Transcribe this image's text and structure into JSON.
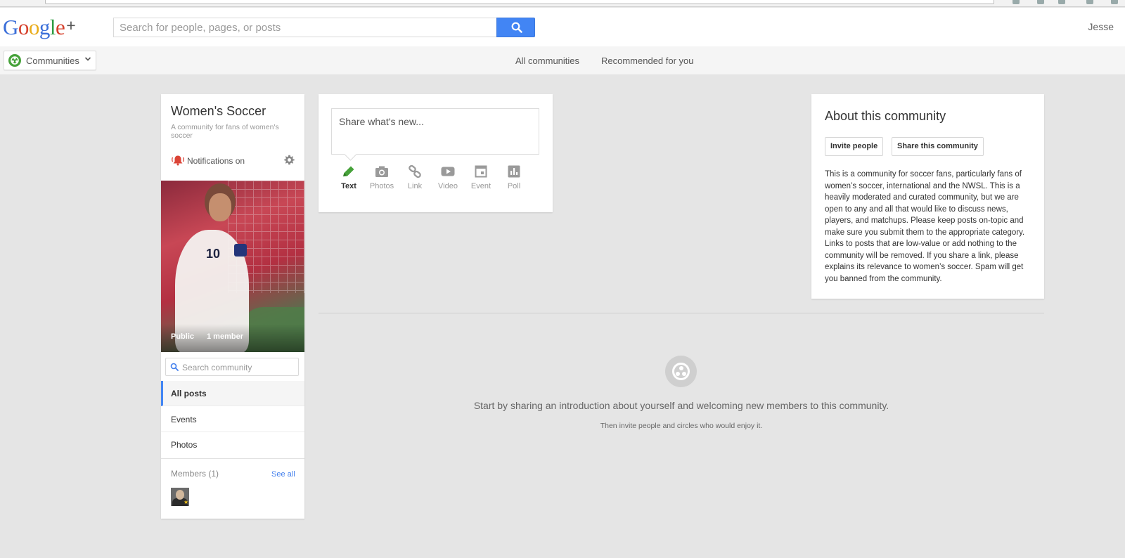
{
  "header": {
    "logo_parts": [
      "G",
      "o",
      "o",
      "g",
      "l",
      "e",
      "+"
    ],
    "search_placeholder": "Search for people, pages, or posts",
    "user_name": "Jesse"
  },
  "subnav": {
    "dropdown_label": "Communities",
    "links": [
      "All communities",
      "Recommended for you"
    ]
  },
  "community": {
    "name": "Women's Soccer",
    "description": "A community for fans of women's soccer",
    "notifications": "Notifications on",
    "cover_tags": [
      "Public",
      "1 member"
    ],
    "cover_jersey_number": "10",
    "search_placeholder": "Search community",
    "nav": [
      {
        "label": "All posts",
        "active": true
      },
      {
        "label": "Events",
        "active": false
      },
      {
        "label": "Photos",
        "active": false
      }
    ],
    "members_label": "Members (1)",
    "see_all": "See all"
  },
  "share": {
    "placeholder": "Share what's new...",
    "options": [
      {
        "label": "Text",
        "icon": "pencil-icon",
        "active": true
      },
      {
        "label": "Photos",
        "icon": "camera-icon",
        "active": false
      },
      {
        "label": "Link",
        "icon": "link-icon",
        "active": false
      },
      {
        "label": "Video",
        "icon": "video-icon",
        "active": false
      },
      {
        "label": "Event",
        "icon": "calendar-icon",
        "active": false
      },
      {
        "label": "Poll",
        "icon": "poll-icon",
        "active": false
      }
    ]
  },
  "about": {
    "title": "About this community",
    "invite_button": "Invite people",
    "share_button": "Share this community",
    "description": "This is a community for soccer fans, particularly fans of women’s soccer, international and the NWSL. This is a heavily moderated and curated community, but we are open to any and all that would like to discuss news, players, and matchups. Please keep posts on-topic and make sure you submit them to the appropriate category. Links to posts that are low-value or add nothing to the community will be removed. If you share a link, please explains its relevance to women’s soccer. Spam will get you banned from the community."
  },
  "empty_state": {
    "headline": "Start by sharing an introduction about yourself and welcoming new members to this community.",
    "subline": "Then invite people and circles who would enjoy it."
  },
  "colors": {
    "accent_blue": "#4285f4",
    "text_active_green": "#46a23a",
    "notif_red": "#db4437",
    "background": "#e5e5e5"
  }
}
